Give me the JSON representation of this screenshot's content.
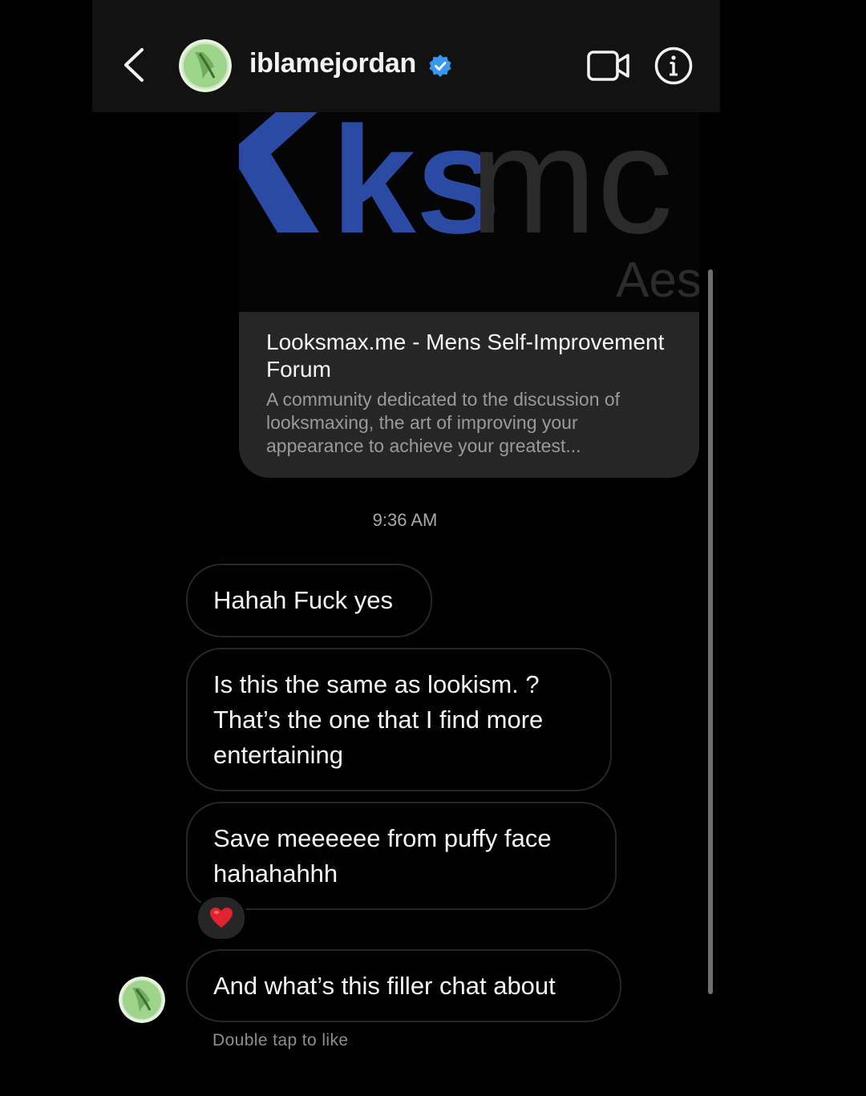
{
  "header": {
    "username": "iblamejordan",
    "verified": true,
    "icons": {
      "back": "chevron-left-icon",
      "verified": "verified-badge-icon",
      "video": "video-camera-icon",
      "info": "info-icon"
    }
  },
  "link_preview": {
    "image_text_primary": "ks",
    "image_text_secondary": "mc",
    "image_subtext": "Aes",
    "title": "Looksmax.me - Mens Self-Improvement Forum",
    "description": "A community dedicated to the discussion of looksmaxing, the art of improving your appearance to achieve your greatest..."
  },
  "timestamp": "9:36 AM",
  "messages": [
    {
      "text": "Hahah Fuck yes"
    },
    {
      "text": "Is this the same as lookism. ? That’s the one that I find more entertaining"
    },
    {
      "text": "Save meeeeee from puffy face hahahahhh",
      "reaction": "heart"
    },
    {
      "text": "And what’s this filler chat about"
    }
  ],
  "hint": "Double tap to like",
  "colors": {
    "background": "#000000",
    "header_bg": "#121212",
    "bubble_border": "#262626",
    "link_card_bg": "#262626",
    "verified_blue": "#3897f0",
    "logo_blue": "#2b4aa3",
    "reaction_red": "#e0242f"
  }
}
